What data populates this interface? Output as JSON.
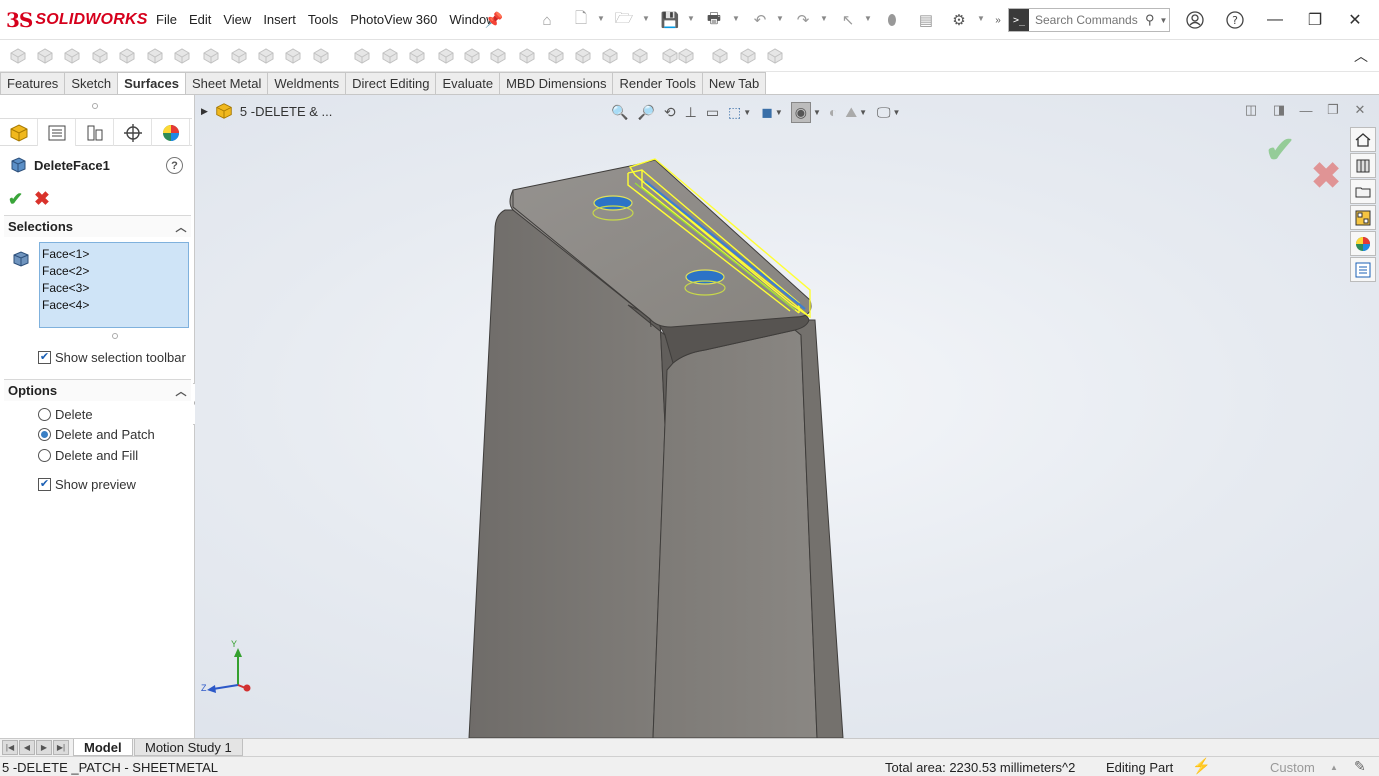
{
  "app": {
    "brand_ds": "3S",
    "brand_name": "SOLIDWORKS"
  },
  "menu": [
    "File",
    "Edit",
    "View",
    "Insert",
    "Tools",
    "PhotoView 360",
    "Window"
  ],
  "search": {
    "placeholder": "Search Commands"
  },
  "tabs": [
    "Features",
    "Sketch",
    "Surfaces",
    "Sheet Metal",
    "Weldments",
    "Direct Editing",
    "Evaluate",
    "MBD Dimensions",
    "Render Tools",
    "New Tab"
  ],
  "active_tab": "Surfaces",
  "property_manager": {
    "title": "DeleteFace1",
    "help": "?",
    "selections": {
      "header": "Selections",
      "items": [
        "Face<1>",
        "Face<2>",
        "Face<3>",
        "Face<4>"
      ],
      "show_toolbar_label": "Show selection toolbar",
      "show_toolbar_checked": true
    },
    "options": {
      "header": "Options",
      "radios": [
        "Delete",
        "Delete and Patch",
        "Delete and Fill"
      ],
      "selected": "Delete and Patch",
      "show_preview_label": "Show preview",
      "show_preview_checked": true
    }
  },
  "graphics": {
    "breadcrumb": "5 -DELETE & ...",
    "triad": {
      "y": "Y",
      "z": "Z"
    }
  },
  "bottom_tabs": [
    "Model",
    "Motion Study 1"
  ],
  "active_bottom_tab": "Model",
  "status": {
    "document": "5 -DELETE _PATCH - SHEETMETAL",
    "total_area": "Total area: 2230.53 millimeters^2",
    "mode": "Editing Part",
    "units": "Custom"
  },
  "colors": {
    "brand_red": "#d6001c",
    "selection_yellow": "#ffff33",
    "selection_list_bg": "#cfe4f7",
    "model_gray": "#7d7b79",
    "ok_green": "#3aa53a",
    "cancel_red": "#d9322b"
  }
}
